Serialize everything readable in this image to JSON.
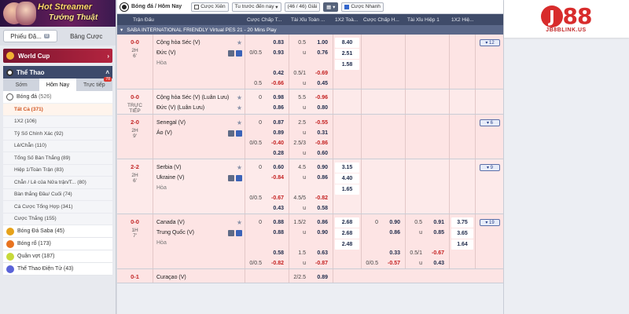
{
  "banner": {
    "line1": "Hot Streamer",
    "line2": "Tướng Thuật"
  },
  "slip_tabs": [
    {
      "label": "Phiếu Đặ...",
      "badge": "0"
    },
    {
      "label": "Bảng Cược"
    }
  ],
  "world_cup": {
    "label": "World Cup"
  },
  "sport_header": {
    "label": "Thể Thao"
  },
  "time_tabs": [
    {
      "label": "Sớm"
    },
    {
      "label": "Hôm Nay"
    },
    {
      "label": "Trực tiếp",
      "badge": "78"
    }
  ],
  "football": {
    "label": "Bóng đá",
    "count": "(526)"
  },
  "football_sub": [
    "Tất Cả (371)",
    "1X2 (106)",
    "Tỷ Số Chính Xác (92)",
    "Lẻ/Chẵn (110)",
    "Tổng Số Bàn Thắng (89)",
    "Hiệp 1/Toàn Trận (83)",
    "Chẵn / Lẻ của Nửa trận/T... (80)",
    "Bàn thắng Đầu/ Cuối (74)",
    "Cá Cược Tổng Hợp (341)",
    "Cược Thắng (155)"
  ],
  "other_sports": [
    {
      "label": "Bóng Đá Saba",
      "count": "(45)",
      "color": "#e6a21a"
    },
    {
      "label": "Bóng rổ",
      "count": "(173)",
      "color": "#e8731f"
    },
    {
      "label": "Quần vợt",
      "count": "(187)",
      "color": "#c7d93a"
    },
    {
      "label": "Thể Thao Điện Tử",
      "count": "(43)",
      "color": "#5a63d8"
    }
  ],
  "topbar": {
    "title": "Bóng đá / Hôm Nay",
    "bet_type": "Cược Xiên",
    "sort": "Tu trước đến nay",
    "count": "(46 / 46) Giải",
    "quick_bet": "Cược Nhanh"
  },
  "columns": [
    "Trận Đấu",
    "Cược Chấp T...",
    "Tài Xỉu Toàn ...",
    "1X2 Toà...",
    "Cược Chấp H...",
    "Tài Xỉu Hiệp 1",
    "1X2 Hiệ..."
  ],
  "league": "SABA INTERNATIONAL FRIENDLY Virtual PES 21 - 20 Mins Play",
  "matches": [
    {
      "score": "0-0",
      "period": "2H",
      "minute": "6'",
      "home": "Cộng hòa Séc (V)",
      "away": "Đức (V)",
      "draw": "Hòa",
      "hdp": [
        [
          "",
          "0.83"
        ],
        [
          "0/0.5",
          "0.93"
        ],
        [
          "",
          ""
        ],
        [
          "",
          "0.42"
        ],
        [
          "0.5",
          "-0.66"
        ]
      ],
      "ou": [
        [
          "0.5",
          "1.00"
        ],
        [
          "u",
          "0.76"
        ],
        [
          "",
          ""
        ],
        [
          "0.5/1",
          "-0.69"
        ],
        [
          "u",
          "0.45"
        ]
      ],
      "x12": [
        "8.40",
        "2.51",
        "1.58"
      ],
      "more": "12",
      "h1": false
    },
    {
      "score": "0-0",
      "period": "TRỰC",
      "minute": "TIẾP",
      "home": "Cộng hòa Séc (V) (Luân Lưu)",
      "away": "Đức (V) (Luân Lưu)",
      "draw": "",
      "hdp": [
        [
          "0",
          "0.98"
        ],
        [
          "",
          "0.86"
        ]
      ],
      "ou": [
        [
          "5.5",
          "-0.96"
        ],
        [
          "u",
          "0.80"
        ]
      ],
      "x12": [],
      "more": "",
      "h1": false
    },
    {
      "score": "2-0",
      "period": "2H",
      "minute": "9'",
      "home": "Senegal (V)",
      "away": "Áo (V)",
      "draw": "",
      "hdp": [
        [
          "0",
          "0.87"
        ],
        [
          "",
          "0.89"
        ],
        [
          "0/0.5",
          "-0.40"
        ],
        [
          "",
          "0.28"
        ]
      ],
      "ou": [
        [
          "2.5",
          "-0.55"
        ],
        [
          "u",
          "0.31"
        ],
        [
          "2.5/3",
          "-0.86"
        ],
        [
          "u",
          "0.60"
        ]
      ],
      "x12": [],
      "more": "6",
      "h1": false
    },
    {
      "score": "2-2",
      "period": "2H",
      "minute": "6'",
      "home": "Serbia (V)",
      "away": "Ukraine (V)",
      "draw": "Hòa",
      "hdp": [
        [
          "0",
          "0.60"
        ],
        [
          "",
          "-0.84"
        ],
        [
          "",
          ""
        ],
        [
          "0/0.5",
          "-0.67"
        ],
        [
          "",
          "0.43"
        ]
      ],
      "ou": [
        [
          "4.5",
          "0.90"
        ],
        [
          "u",
          "0.86"
        ],
        [
          "",
          ""
        ],
        [
          "4.5/5",
          "-0.82"
        ],
        [
          "u",
          "0.58"
        ]
      ],
      "x12": [
        "3.15",
        "4.40",
        "1.65"
      ],
      "more": "9",
      "h1": false
    },
    {
      "score": "0-0",
      "period": "1H",
      "minute": "7'",
      "home": "Canada (V)",
      "away": "Trung Quốc (V)",
      "draw": "Hòa",
      "hdp": [
        [
          "0",
          "0.88"
        ],
        [
          "",
          "0.88"
        ],
        [
          "",
          ""
        ],
        [
          "",
          "0.58"
        ],
        [
          "0/0.5",
          "-0.82"
        ]
      ],
      "ou": [
        [
          "1.5/2",
          "0.86"
        ],
        [
          "u",
          "0.90"
        ],
        [
          "",
          ""
        ],
        [
          "1.5",
          "0.63"
        ],
        [
          "u",
          "-0.87"
        ]
      ],
      "x12": [
        "2.68",
        "2.68",
        "2.48"
      ],
      "h1hdp": [
        [
          "0",
          "0.90"
        ],
        [
          "",
          "0.86"
        ],
        [
          "",
          ""
        ],
        [
          "",
          "0.33"
        ],
        [
          "0/0.5",
          "-0.57"
        ]
      ],
      "h1ou": [
        [
          "0.5",
          "0.91"
        ],
        [
          "u",
          "0.85"
        ],
        [
          "",
          ""
        ],
        [
          "0.5/1",
          "-0.67"
        ],
        [
          "u",
          "0.43"
        ]
      ],
      "h1x12": [
        "3.75",
        "3.65",
        "1.64"
      ],
      "more": "19",
      "h1": true
    }
  ],
  "partial_match": {
    "score": "0-1",
    "home": "Curaçao (V)",
    "ou": "2/2.5",
    "val": "0.89"
  },
  "brand": {
    "name_left": "J",
    "name_circle": "J",
    "name_right": "88",
    "url": "JB8BLINK.US"
  }
}
